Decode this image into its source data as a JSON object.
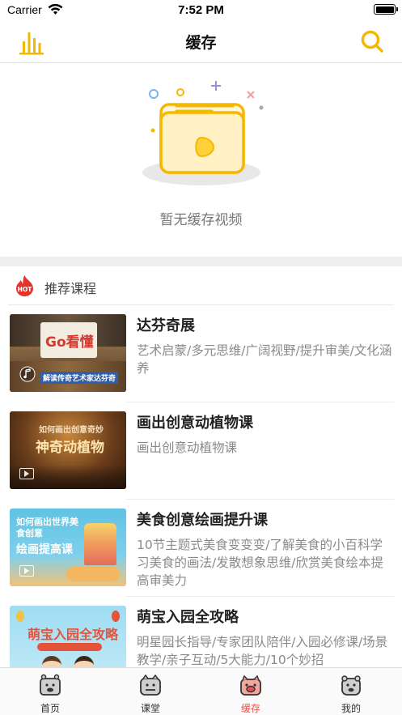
{
  "status_bar": {
    "carrier": "Carrier",
    "time": "7:52 PM"
  },
  "nav": {
    "title": "缓存",
    "left_icon": "bar-chart-icon",
    "right_icon": "search-icon",
    "accent_color": "#f5b800"
  },
  "empty_state": {
    "message": "暂无缓存视频",
    "icon": "empty-video-folder-icon"
  },
  "recommend": {
    "badge": "HOT",
    "title": "推荐课程"
  },
  "courses": [
    {
      "title": "达芬奇展",
      "description": "艺术启蒙/多元思维/广阔视野/提升审美/文化涵养",
      "thumb_text": "Go看懂",
      "thumb_caption": "解读传奇艺术家达芬奇",
      "media_icon": "music-note-icon"
    },
    {
      "title": "画出创意动植物课",
      "description": "画出创意动植物课",
      "thumb_text": "神奇动植物",
      "thumb_caption": "如何画出创意奇妙",
      "media_icon": "video-icon"
    },
    {
      "title": "美食创意绘画提升课",
      "description": "10节主题式美食变变变/了解美食的小百科学习美食的画法/发散想象思维/欣赏美食绘本提高审美力",
      "thumb_text": "绘画提高课",
      "thumb_caption": "如何画出世界美食创意",
      "media_icon": "video-icon"
    },
    {
      "title": "萌宝入园全攻略",
      "description": "明星园长指导/专家团队陪伴/入园必修课/场景教学/亲子互动/5大能力/10个妙招",
      "thumb_text": "萌宝入园全攻略",
      "thumb_caption": "",
      "media_icon": "video-icon"
    }
  ],
  "tab_bar": {
    "active_color": "#e5534b",
    "tabs": [
      {
        "label": "首页",
        "icon": "home-tab-icon",
        "active": false
      },
      {
        "label": "课堂",
        "icon": "classroom-tab-icon",
        "active": false
      },
      {
        "label": "缓存",
        "icon": "cache-tab-icon",
        "active": true
      },
      {
        "label": "我的",
        "icon": "profile-tab-icon",
        "active": false
      }
    ]
  }
}
